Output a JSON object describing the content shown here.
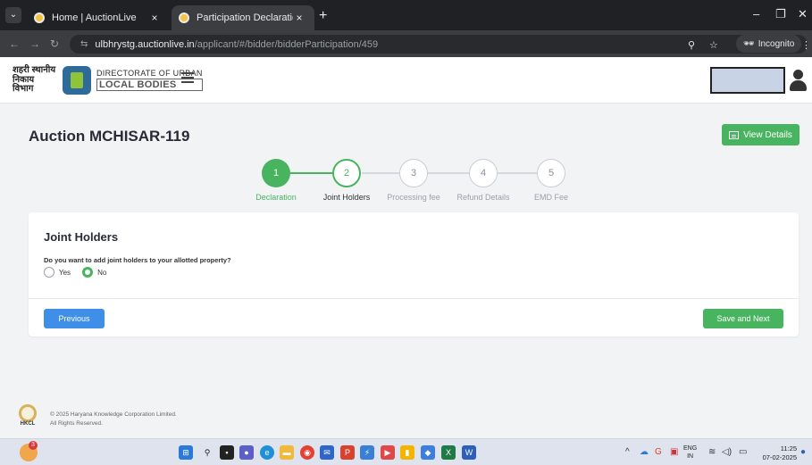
{
  "browser": {
    "tabs": [
      {
        "title": "Home | AuctionLive",
        "active": false
      },
      {
        "title": "Participation Declaration",
        "active": true
      }
    ],
    "url_host": "ulbhrystg.auctionlive.in",
    "url_path": "/applicant/#/bidder/bidderParticipation/459",
    "incognito_label": "Incognito"
  },
  "header": {
    "logo_hindi": "शहरी स्थानीय निकाय विभाग",
    "logo_english_top": "DIRECTORATE OF URBAN",
    "logo_english_main": "LOCAL BODIES"
  },
  "page": {
    "title": "Auction MCHISAR-119",
    "view_details_label": "View Details"
  },
  "stepper": {
    "steps": [
      {
        "number": "1",
        "label": "Declaration",
        "state": "done"
      },
      {
        "number": "2",
        "label": "Joint Holders",
        "state": "current"
      },
      {
        "number": "3",
        "label": "Processing fee",
        "state": "todo"
      },
      {
        "number": "4",
        "label": "Refund Details",
        "state": "todo"
      },
      {
        "number": "5",
        "label": "EMD Fee",
        "state": "todo"
      }
    ]
  },
  "card": {
    "title": "Joint Holders",
    "question": "Do you want to add joint holders to your allotted property?",
    "options": [
      {
        "label": "Yes",
        "checked": false
      },
      {
        "label": "No",
        "checked": true
      }
    ],
    "previous_label": "Previous",
    "next_label": "Save and Next"
  },
  "footer": {
    "logo_text": "HKCL",
    "copyright": "© 2025 Haryana Knowledge Corporation Limited.",
    "rights": "All Rights Reserved."
  },
  "taskbar": {
    "weather_badge": "3",
    "lang_top": "ENG",
    "lang_bottom": "IN",
    "time": "11:25",
    "date": "07-02-2025"
  },
  "colors": {
    "accent_green": "#48b45f",
    "accent_blue": "#3f8ee8",
    "page_bg": "#f2f3f5"
  }
}
